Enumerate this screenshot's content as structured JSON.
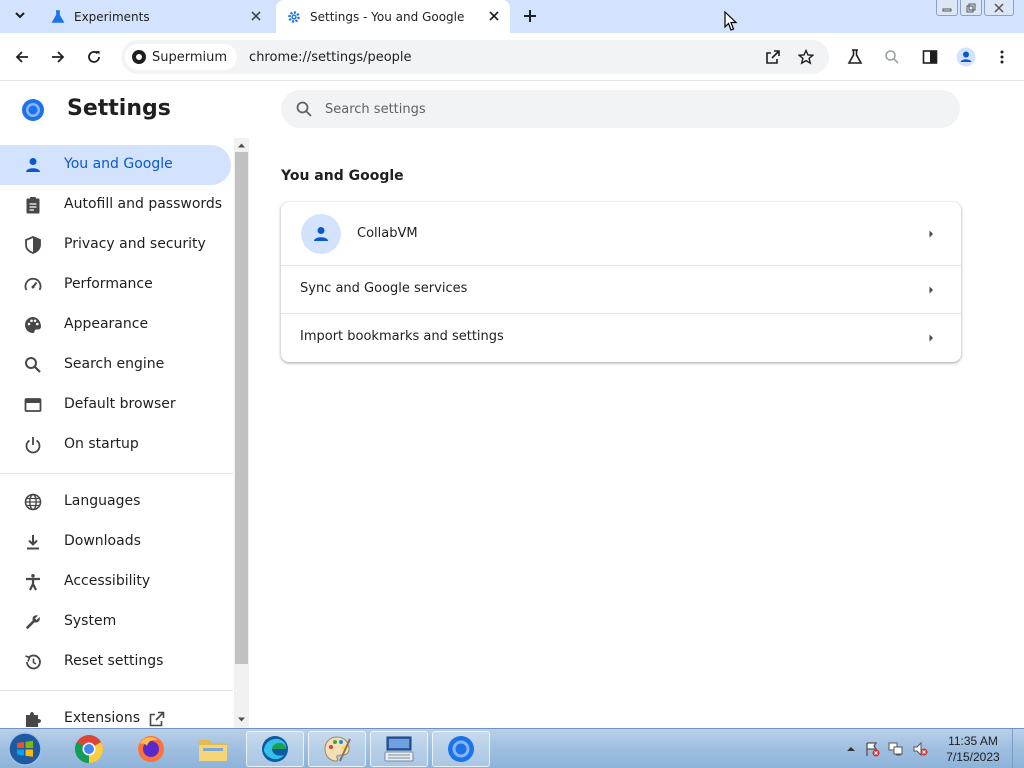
{
  "tabs": [
    {
      "label": "Experiments",
      "favicon": "flask-icon"
    },
    {
      "label": "Settings - You and Google",
      "favicon": "gear-icon",
      "active": true
    }
  ],
  "toolbar": {
    "site_chip": "Supermium",
    "url": "chrome://settings/people"
  },
  "settings": {
    "title": "Settings",
    "search_placeholder": "Search settings"
  },
  "sidebar": {
    "items": [
      {
        "label": "You and Google",
        "icon": "person-icon",
        "active": true
      },
      {
        "label": "Autofill and passwords",
        "icon": "clipboard-icon"
      },
      {
        "label": "Privacy and security",
        "icon": "shield-icon"
      },
      {
        "label": "Performance",
        "icon": "speedometer-icon"
      },
      {
        "label": "Appearance",
        "icon": "palette-icon"
      },
      {
        "label": "Search engine",
        "icon": "search-icon"
      },
      {
        "label": "Default browser",
        "icon": "browser-window-icon"
      },
      {
        "label": "On startup",
        "icon": "power-icon"
      },
      {
        "label": "Languages",
        "icon": "globe-icon"
      },
      {
        "label": "Downloads",
        "icon": "download-icon"
      },
      {
        "label": "Accessibility",
        "icon": "accessibility-icon"
      },
      {
        "label": "System",
        "icon": "wrench-icon"
      },
      {
        "label": "Reset settings",
        "icon": "reset-history-icon"
      },
      {
        "label": "Extensions",
        "icon": "puzzle-icon"
      }
    ]
  },
  "content": {
    "section_title": "You and Google",
    "account_name": "CollabVM",
    "rows": [
      {
        "label": "Sync and Google services"
      },
      {
        "label": "Import bookmarks and settings"
      }
    ]
  },
  "taskbar": {
    "time": "11:35 AM",
    "date": "7/15/2023",
    "apps": [
      "chrome-icon",
      "firefox-icon",
      "file-explorer-icon",
      "edge-icon",
      "paint-icon",
      "keyboard-icon",
      "supermium-icon"
    ]
  },
  "colors": {
    "accent": "#0b57d0",
    "active_nav_bg": "#d3e3fd",
    "tab_strip": "#d3e3fd"
  }
}
